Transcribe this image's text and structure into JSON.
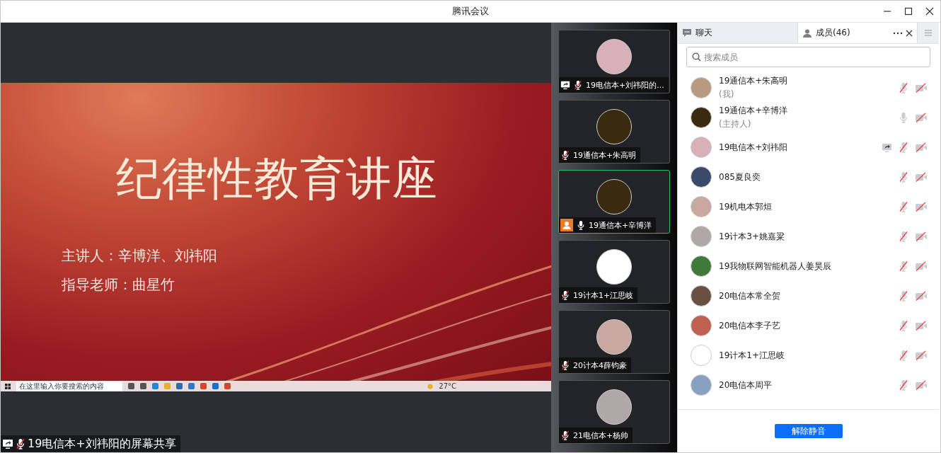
{
  "window": {
    "title": "腾讯会议"
  },
  "shared_screen": {
    "slide": {
      "title": "纪律性教育讲座",
      "lines": [
        "主讲人：辛博洋、刘祎阳",
        "指导老师：曲星竹"
      ]
    },
    "taskbar": {
      "search_placeholder": "在这里输入你要搜索的内容",
      "weather": "27°C"
    },
    "label": "19电信本+刘祎阳的屏幕共享",
    "sharing": true,
    "muted": true
  },
  "video_tiles": [
    {
      "name": "19电信本+刘祎阳的...",
      "sharing": true,
      "host": false,
      "muted": true,
      "selected": false
    },
    {
      "name": "19通信本+朱高明",
      "sharing": false,
      "host": false,
      "muted": true,
      "selected": false
    },
    {
      "name": "19通信本+辛博洋",
      "sharing": false,
      "host": true,
      "muted": false,
      "selected": true
    },
    {
      "name": "19计本1+江思岐",
      "sharing": false,
      "host": false,
      "muted": true,
      "selected": false
    },
    {
      "name": "20计本4薛钧豪",
      "sharing": false,
      "host": false,
      "muted": true,
      "selected": false
    },
    {
      "name": "21电信本+杨帅",
      "sharing": false,
      "host": false,
      "muted": true,
      "selected": false
    }
  ],
  "side_panel": {
    "tabs": [
      {
        "label": "聊天",
        "kind": "chat",
        "selected": false
      },
      {
        "label": "成员(46)",
        "kind": "members",
        "selected": true
      }
    ],
    "search": {
      "placeholder": "搜索成员"
    },
    "members": [
      {
        "name": "19通信本+朱高明",
        "role": "(我)",
        "sharing": false,
        "muted": true
      },
      {
        "name": "19通信本+辛博洋",
        "role": "(主持人)",
        "sharing": false,
        "muted": false
      },
      {
        "name": "19电信本+刘祎阳",
        "sharing": true,
        "muted": true
      },
      {
        "name": "085夏良奕",
        "sharing": false,
        "muted": true
      },
      {
        "name": "19机电本郭烜",
        "sharing": false,
        "muted": true
      },
      {
        "name": "19计本3+姚嘉粱",
        "sharing": false,
        "muted": true
      },
      {
        "name": "19我物联网智能机器人姜昊辰",
        "sharing": false,
        "muted": true
      },
      {
        "name": "20电信本常全贺",
        "sharing": false,
        "muted": true
      },
      {
        "name": "20电信本李子艺",
        "sharing": false,
        "muted": true
      },
      {
        "name": "19计本1+江思岐",
        "sharing": false,
        "muted": true
      },
      {
        "name": "20电信本周平",
        "sharing": false,
        "muted": true
      }
    ],
    "unmute_button": "解除静音"
  }
}
